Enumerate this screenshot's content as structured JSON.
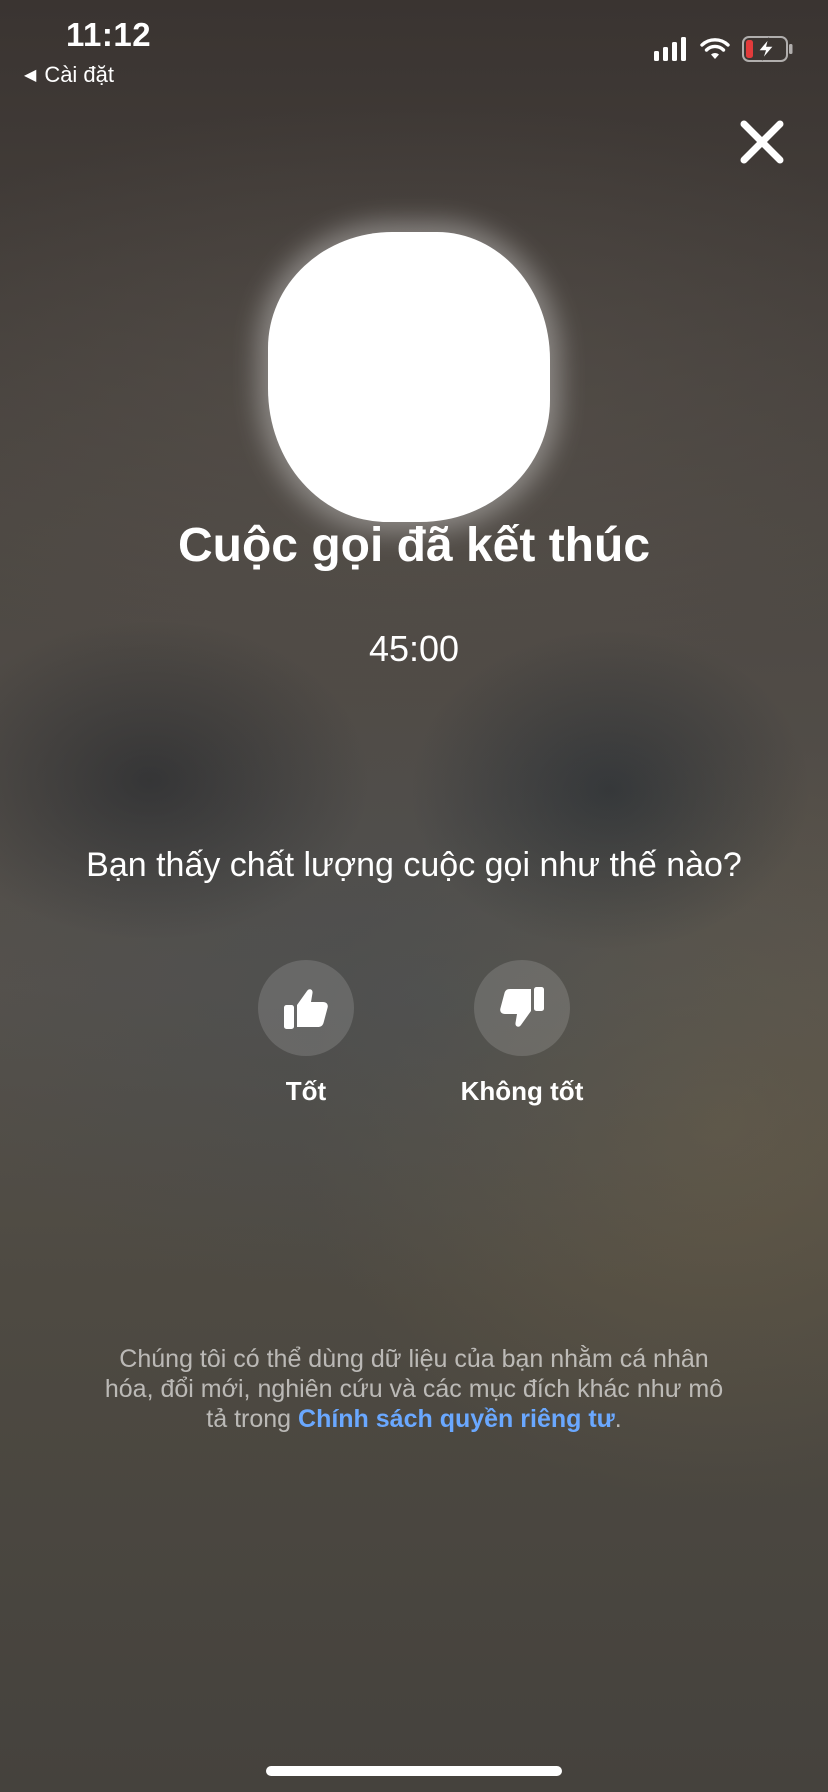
{
  "status_bar": {
    "time": "11:12",
    "back_app": "Cài đặt",
    "battery_color": "#e23b3b"
  },
  "call_end": {
    "title": "Cuộc gọi đã kết thúc",
    "duration": "45:00",
    "question": "Bạn thấy chất lượng cuộc gọi như thế nào?",
    "good_label": "Tốt",
    "bad_label": "Không tốt"
  },
  "privacy": {
    "text_before": "Chúng tôi có thể dùng dữ liệu của bạn nhằm cá nhân hóa, đổi mới, nghiên cứu và các mục đích khác như mô tả trong ",
    "link_text": "Chính sách quyền riêng tư",
    "text_after": ".",
    "link_color": "#6aa8ff"
  },
  "icons": {
    "close": "close-icon",
    "thumbs_up": "thumbs-up-icon",
    "thumbs_down": "thumbs-down-icon",
    "signal": "cellular-signal-icon",
    "wifi": "wifi-icon",
    "battery": "battery-charging-icon"
  }
}
